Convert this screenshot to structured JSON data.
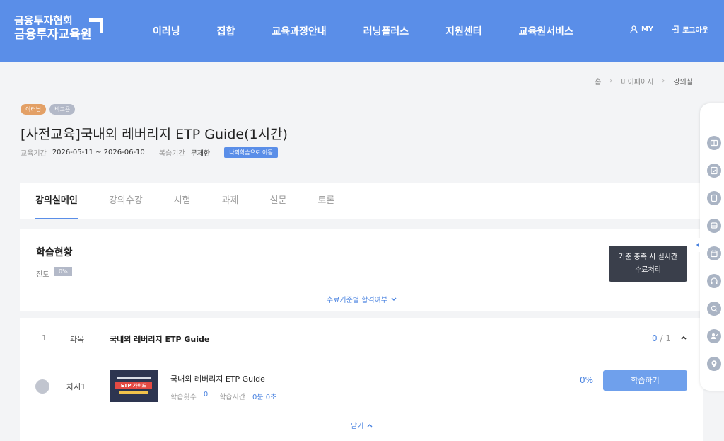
{
  "header": {
    "logo_line1": "금융투자협회",
    "logo_line2": "금융투자교육원",
    "nav": [
      "이러닝",
      "집합",
      "교육과정안내",
      "러닝플러스",
      "지원센터",
      "교육원서비스"
    ],
    "my_label": "MY",
    "logout_label": "로그아웃"
  },
  "breadcrumb": [
    "홈",
    "마이페이지",
    "강의실"
  ],
  "course": {
    "badges": [
      "이러닝",
      "비고용"
    ],
    "title": "[사전교육]국내외 레버리지 ETP Guide(1시간)",
    "period_label": "교육기간",
    "period_value": "2026-05-11 ~ 2026-06-10",
    "review_label": "복습기간",
    "review_value": "무제한",
    "goto_button": "나의학습으로 이동"
  },
  "tabs": [
    "강의실메인",
    "강의수강",
    "시험",
    "과제",
    "설문",
    "토론"
  ],
  "status": {
    "title": "학습현황",
    "progress_label": "진도",
    "progress_value": "0%",
    "criteria_link": "수료기준별 합격여부"
  },
  "tooltip": {
    "line1": "기준 충족 시 실시간",
    "line2": "수료처리"
  },
  "subject": {
    "number": "1",
    "kind": "과목",
    "name": "국내외 레버리지 ETP Guide",
    "done": "0",
    "total": "/ 1",
    "lesson": {
      "label": "차시1",
      "title": "국내외 레버리지 ETP Guide",
      "thumb_text": "ETP 가이드",
      "count_label": "학습횟수",
      "count_value": "0",
      "time_label": "학습시간",
      "time_value": "0분 0초",
      "percent": "0%",
      "study_button": "학습하기"
    },
    "close_label": "닫기"
  },
  "quickbar_icons": [
    "book-icon",
    "checklist-icon",
    "tablet-icon",
    "bus-icon",
    "calendar-icon",
    "headset-icon",
    "search-icon",
    "user-check-icon",
    "location-icon"
  ],
  "colors": {
    "primary": "#5a8ee8",
    "accent": "#4a83e0",
    "tooltip_bg": "#3a3f4b"
  }
}
